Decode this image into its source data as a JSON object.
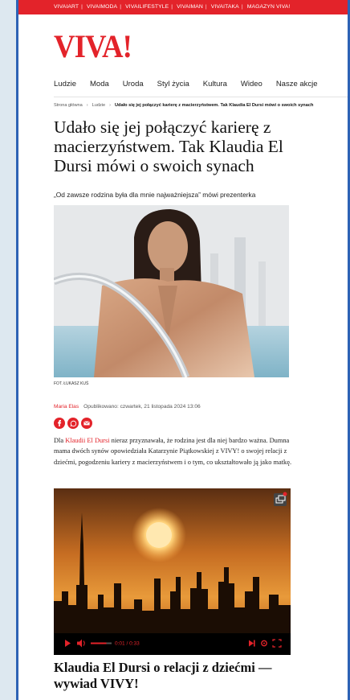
{
  "topbar": {
    "links": [
      "VIVAIART",
      "VIVAIMODA",
      "VIVAILIFESTYLE",
      "VIVAIMAN",
      "VIVAITAKA",
      "MAGAZYN VIVA!"
    ]
  },
  "logo": "VIVA!",
  "nav": [
    "Ludzie",
    "Moda",
    "Uroda",
    "Styl życia",
    "Kultura",
    "Wideo",
    "Nasze akcje"
  ],
  "breadcrumb": {
    "home": "Strona główna",
    "section": "Ludzie",
    "current": "Udało się jej połączyć karierę z macierzyństwem. Tak Klaudia El Dursi mówi o swoich synach"
  },
  "article": {
    "title": "Udało się jej połączyć karierę z macierzyństwem. Tak Klaudia El Dursi mówi o swoich synach",
    "lead": "„Od zawsze rodzina była dla mnie najważniejsza” mówi prezenterka",
    "photo_caption": "FOT. ŁUKASZ KUŚ",
    "author": "Maria Elas",
    "published": "Opublikowano: czwartek, 21 listopada 2024 13:06",
    "body_pre": "Dla ",
    "body_link": "Klaudii El Dursi",
    "body_post": " nieraz przyznawała, że rodzina jest dla niej bardzo ważna. Dumna mama dwóch synów opowiedziała Katarzynie Piątkowskiej z VIVY! o swojej relacji z dziećmi, pogodzeniu kariery z macierzyństwem i o tym, co ukształtowało ją jako matkę."
  },
  "share_icons": [
    "facebook-icon",
    "whatsapp-icon",
    "email-icon"
  ],
  "video": {
    "time": "0:01 / 0:33",
    "progress": 0.08,
    "volume": 0.75,
    "title": "Klaudia El Dursi o relacji z dziećmi — wywiad VIVY!"
  },
  "colors": {
    "brand": "#e3232a",
    "frame": "#2d62b5"
  }
}
